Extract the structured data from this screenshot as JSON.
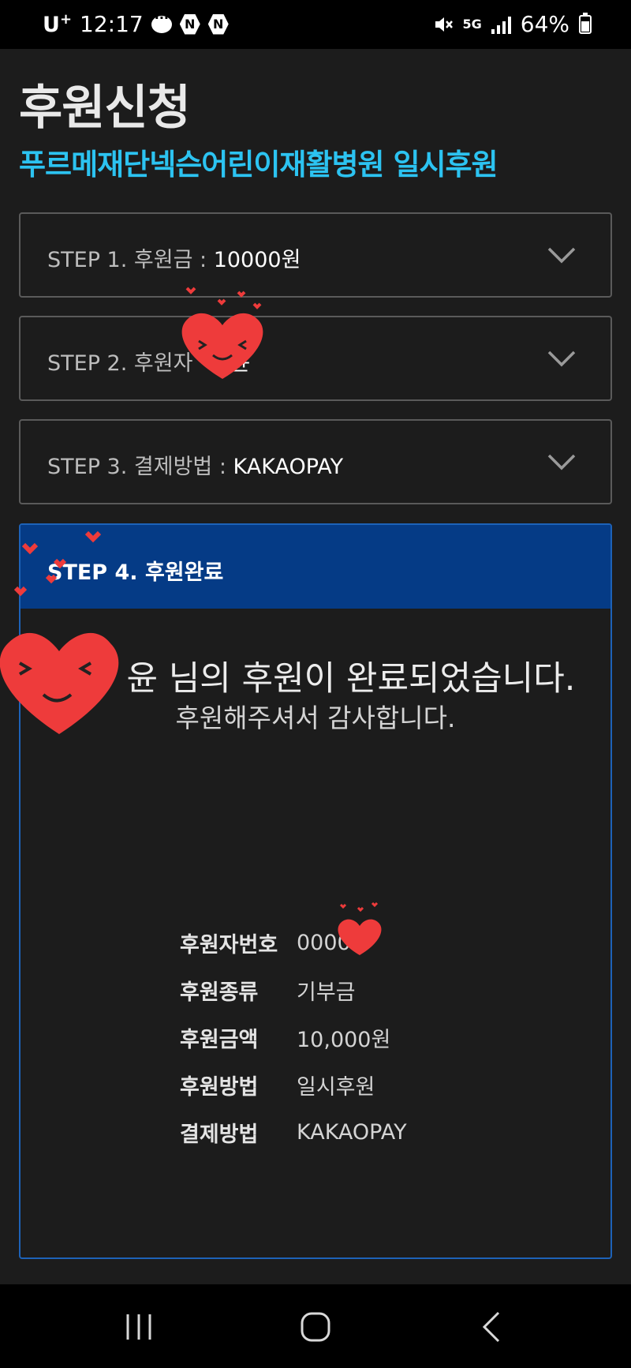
{
  "status_bar": {
    "carrier": "U",
    "carrier_sup": "+",
    "time": "12:17",
    "network": "5G",
    "battery": "64%",
    "icons": [
      "chat-icon",
      "naver-icon",
      "naver-icon",
      "mute-icon",
      "network-5g-icon",
      "signal-icon",
      "battery-icon"
    ]
  },
  "page": {
    "title": "후원신청",
    "subtitle": "푸르메재단넥슨어린이재활병원 일시후원"
  },
  "steps": [
    {
      "label": "STEP 1. 후원금 : ",
      "value": "10000원"
    },
    {
      "label": "STEP 2. 후원자",
      "value": "윤"
    },
    {
      "label": "STEP 3. 결제방법 : ",
      "value": "KAKAOPAY"
    }
  ],
  "step4": {
    "title": "STEP 4. 후원완료",
    "complete_message": "윤 님의 후원이 완료되었습니다.",
    "thanks_message": "후원해주셔서 감사합니다.",
    "details": [
      {
        "key": "후원자번호",
        "value": "0000 5"
      },
      {
        "key": "후원종류",
        "value": "기부금"
      },
      {
        "key": "후원금액",
        "value": "10,000원"
      },
      {
        "key": "후원방법",
        "value": "일시후원"
      },
      {
        "key": "결제방법",
        "value": "KAKAOPAY"
      }
    ]
  },
  "colors": {
    "background": "#1c1c1c",
    "accent": "#2cc3f1",
    "step4_header": "#053b86",
    "step4_border": "#1d62b8"
  }
}
